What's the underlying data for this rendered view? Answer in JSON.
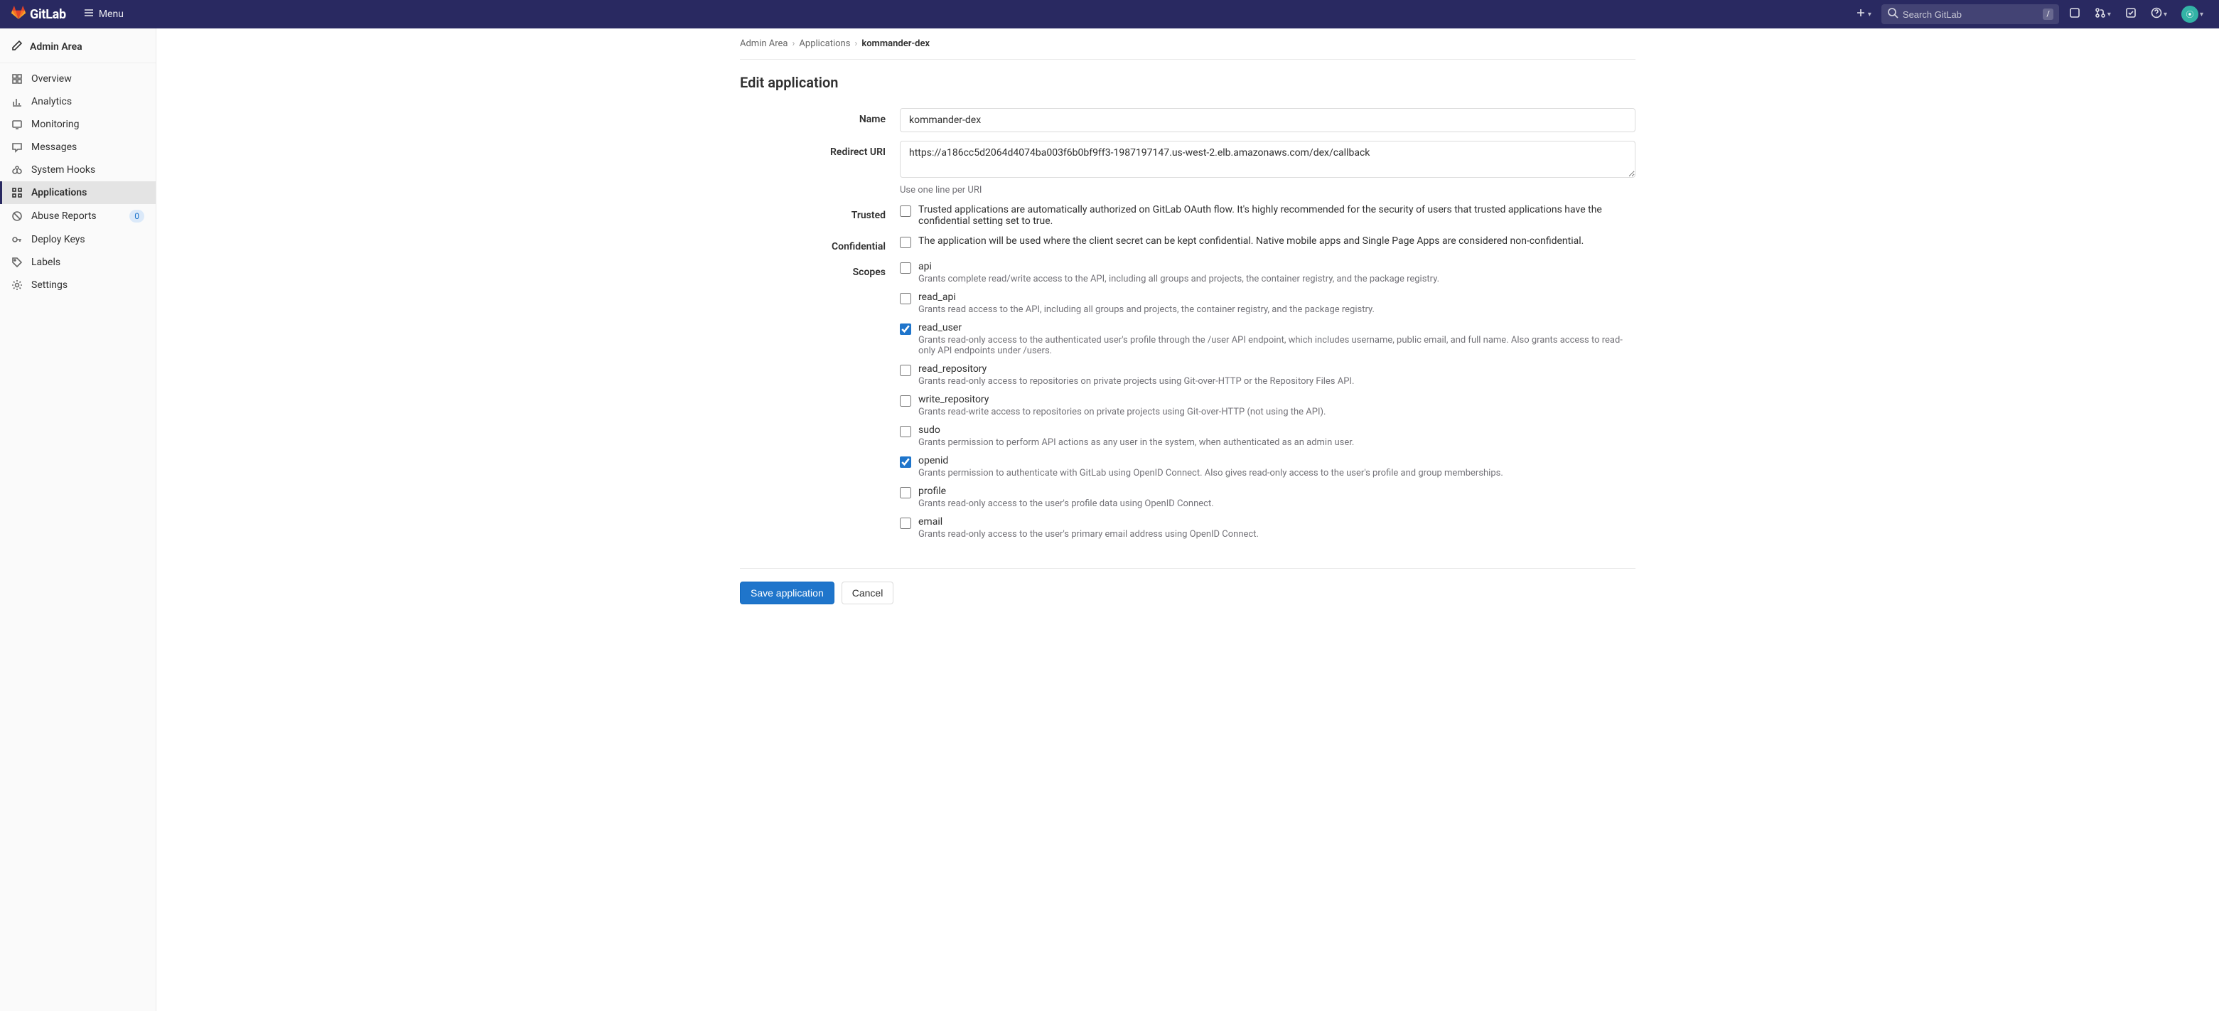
{
  "colors": {
    "nav_bg": "#292961",
    "primary": "#1f75cb"
  },
  "header": {
    "brand": "GitLab",
    "menu_label": "Menu",
    "search_placeholder": "Search GitLab",
    "search_kbd": "/"
  },
  "sidebar": {
    "title": "Admin Area",
    "items": [
      {
        "label": "Overview",
        "icon": "overview"
      },
      {
        "label": "Analytics",
        "icon": "analytics"
      },
      {
        "label": "Monitoring",
        "icon": "monitoring"
      },
      {
        "label": "Messages",
        "icon": "messages"
      },
      {
        "label": "System Hooks",
        "icon": "hooks"
      },
      {
        "label": "Applications",
        "icon": "applications",
        "active": true
      },
      {
        "label": "Abuse Reports",
        "icon": "abuse",
        "badge": "0"
      },
      {
        "label": "Deploy Keys",
        "icon": "keys"
      },
      {
        "label": "Labels",
        "icon": "labels"
      },
      {
        "label": "Settings",
        "icon": "settings"
      }
    ]
  },
  "breadcrumbs": {
    "a": "Admin Area",
    "b": "Applications",
    "c": "kommander-dex"
  },
  "page": {
    "title": "Edit application",
    "labels": {
      "name": "Name",
      "redirect_uri": "Redirect URI",
      "trusted": "Trusted",
      "confidential": "Confidential",
      "scopes": "Scopes"
    },
    "name_value": "kommander-dex",
    "redirect_uri_value": "https://a186cc5d2064d4074ba003f6b0bf9ff3-1987197147.us-west-2.elb.amazonaws.com/dex/callback",
    "redirect_uri_help": "Use one line per URI",
    "trusted_desc": "Trusted applications are automatically authorized on GitLab OAuth flow. It's highly recommended for the security of users that trusted applications have the confidential setting set to true.",
    "confidential_desc": "The application will be used where the client secret can be kept confidential. Native mobile apps and Single Page Apps are considered non-confidential.",
    "scopes": [
      {
        "key": "api",
        "label": "api",
        "desc": "Grants complete read/write access to the API, including all groups and projects, the container registry, and the package registry.",
        "checked": false
      },
      {
        "key": "read_api",
        "label": "read_api",
        "desc": "Grants read access to the API, including all groups and projects, the container registry, and the package registry.",
        "checked": false
      },
      {
        "key": "read_user",
        "label": "read_user",
        "desc": "Grants read-only access to the authenticated user's profile through the /user API endpoint, which includes username, public email, and full name. Also grants access to read-only API endpoints under /users.",
        "checked": true
      },
      {
        "key": "read_repository",
        "label": "read_repository",
        "desc": "Grants read-only access to repositories on private projects using Git-over-HTTP or the Repository Files API.",
        "checked": false
      },
      {
        "key": "write_repository",
        "label": "write_repository",
        "desc": "Grants read-write access to repositories on private projects using Git-over-HTTP (not using the API).",
        "checked": false
      },
      {
        "key": "sudo",
        "label": "sudo",
        "desc": "Grants permission to perform API actions as any user in the system, when authenticated as an admin user.",
        "checked": false
      },
      {
        "key": "openid",
        "label": "openid",
        "desc": "Grants permission to authenticate with GitLab using OpenID Connect. Also gives read-only access to the user's profile and group memberships.",
        "checked": true
      },
      {
        "key": "profile",
        "label": "profile",
        "desc": "Grants read-only access to the user's profile data using OpenID Connect.",
        "checked": false
      },
      {
        "key": "email",
        "label": "email",
        "desc": "Grants read-only access to the user's primary email address using OpenID Connect.",
        "checked": false
      }
    ],
    "buttons": {
      "save": "Save application",
      "cancel": "Cancel"
    }
  }
}
